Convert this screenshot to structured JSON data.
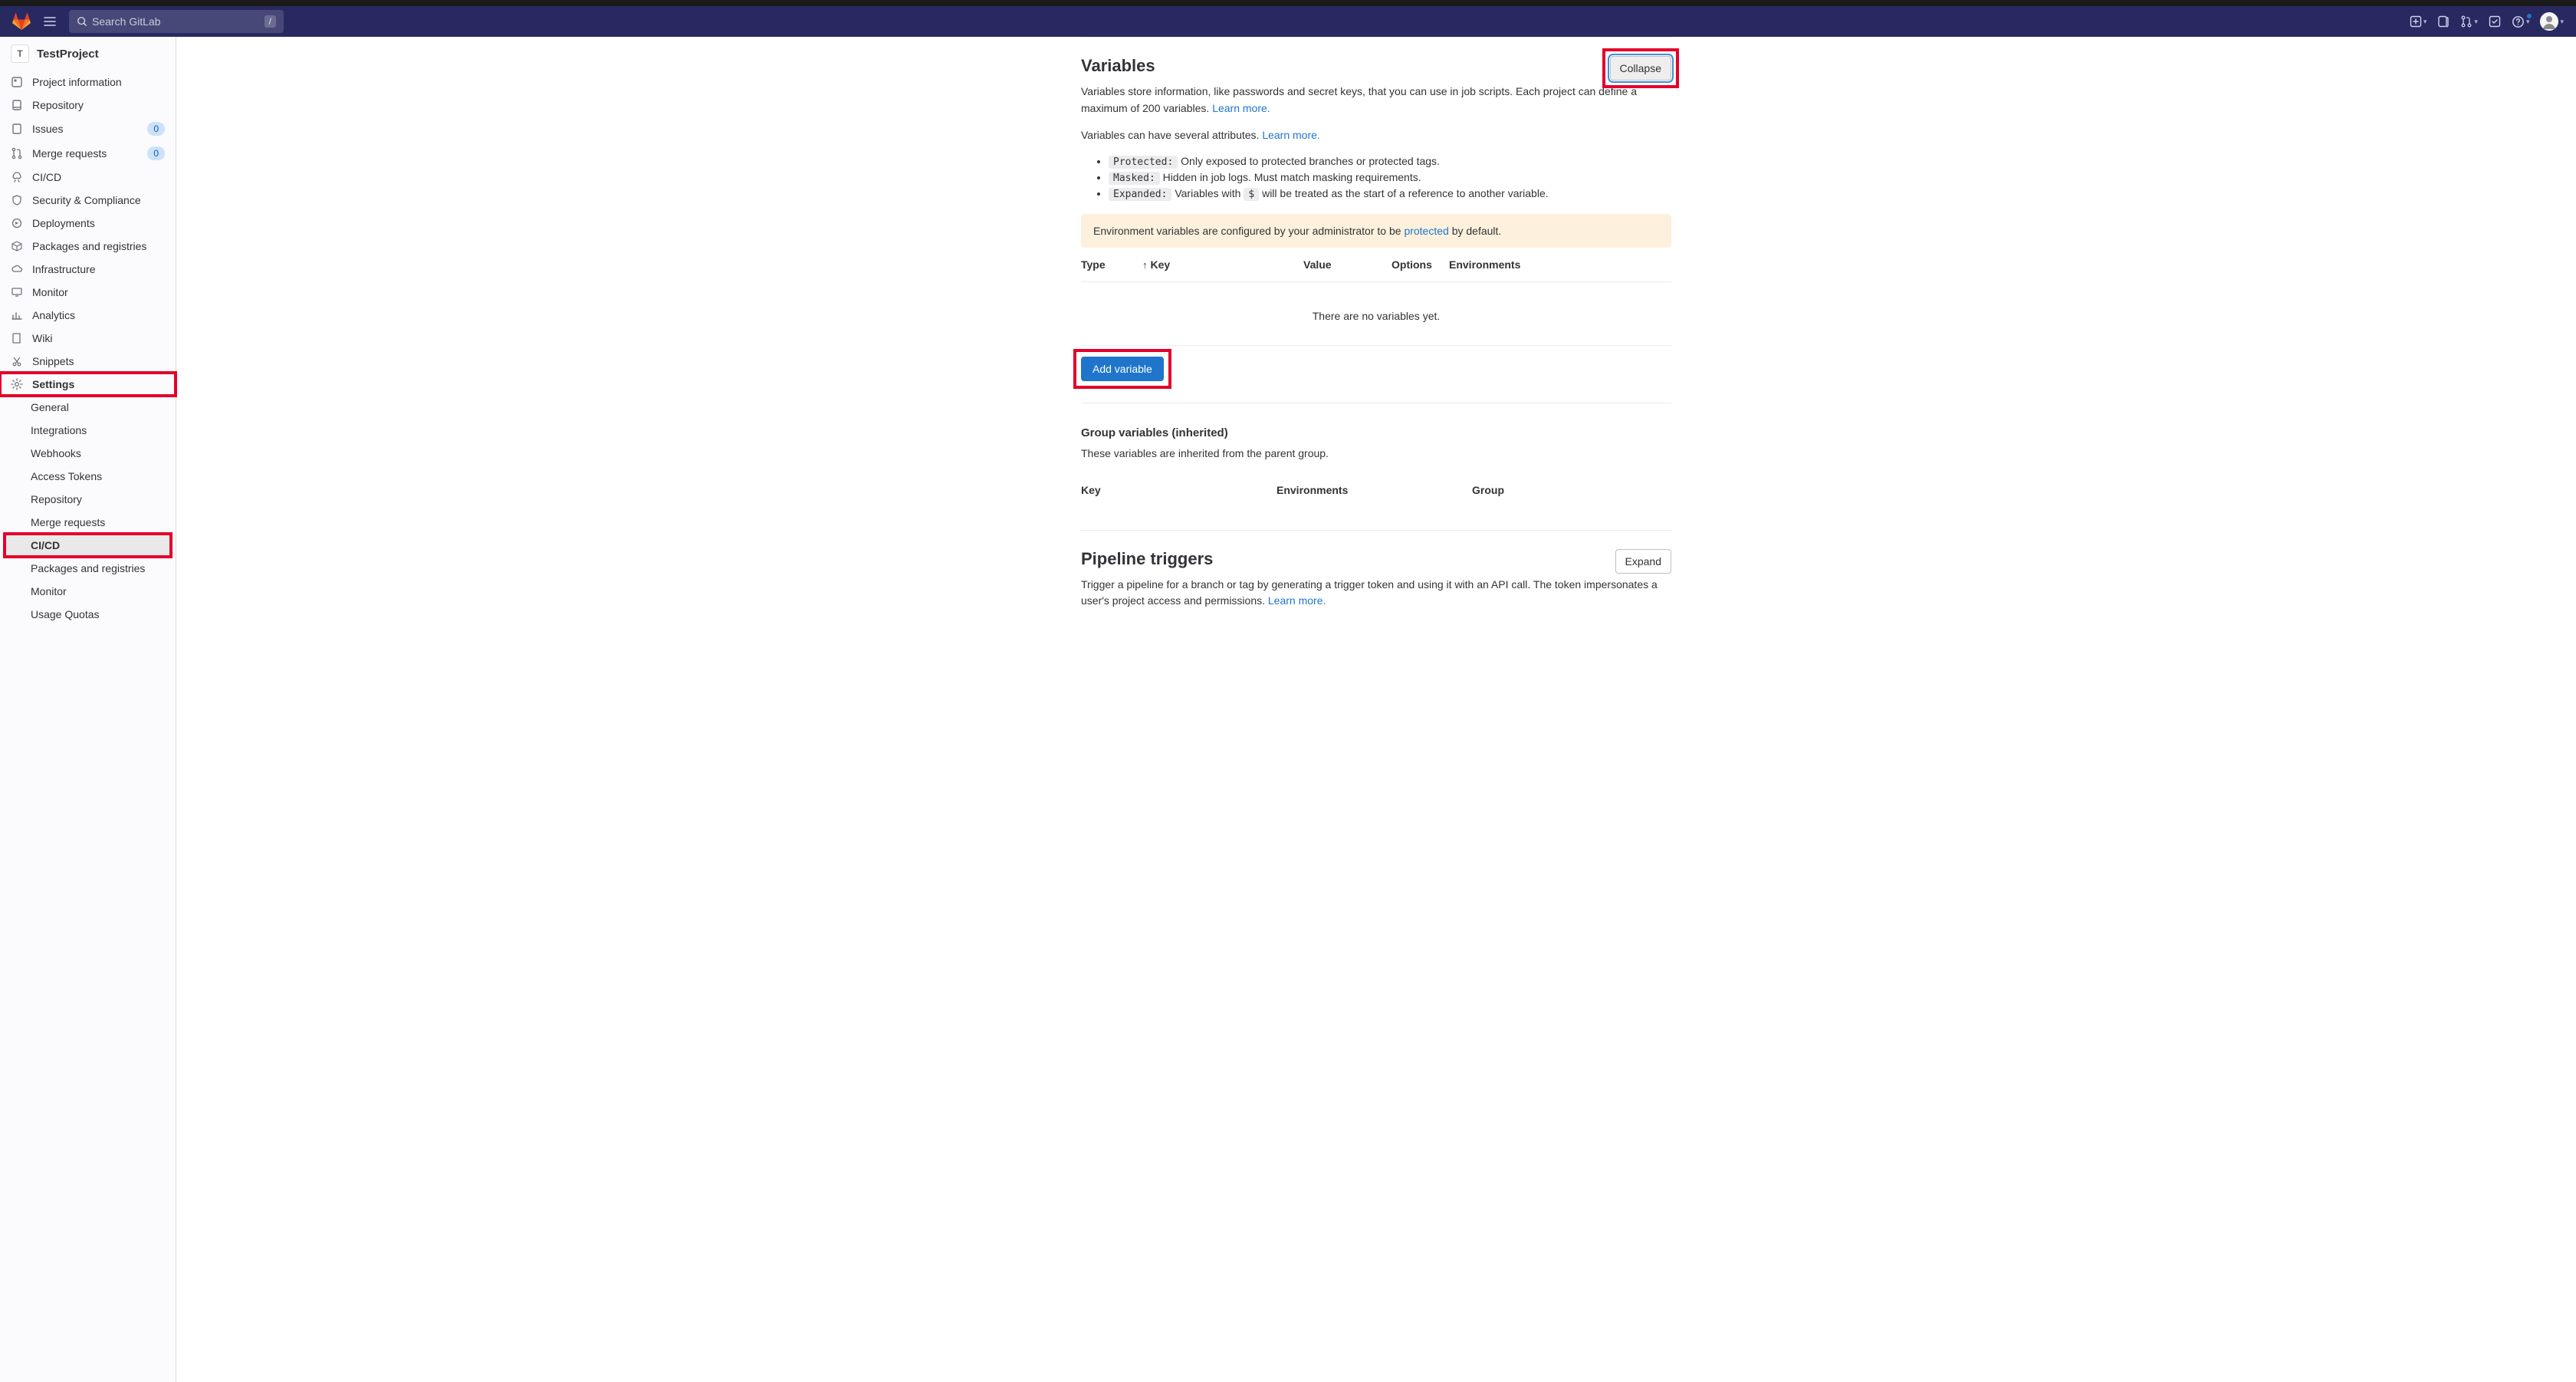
{
  "topbar": {
    "search_placeholder": "Search GitLab",
    "search_kbd": "/"
  },
  "project": {
    "avatar_letter": "T",
    "name": "TestProject"
  },
  "sidebar": {
    "items": [
      {
        "label": "Project information"
      },
      {
        "label": "Repository"
      },
      {
        "label": "Issues",
        "badge": "0"
      },
      {
        "label": "Merge requests",
        "badge": "0"
      },
      {
        "label": "CI/CD"
      },
      {
        "label": "Security & Compliance"
      },
      {
        "label": "Deployments"
      },
      {
        "label": "Packages and registries"
      },
      {
        "label": "Infrastructure"
      },
      {
        "label": "Monitor"
      },
      {
        "label": "Analytics"
      },
      {
        "label": "Wiki"
      },
      {
        "label": "Snippets"
      },
      {
        "label": "Settings"
      }
    ],
    "sub": [
      {
        "label": "General"
      },
      {
        "label": "Integrations"
      },
      {
        "label": "Webhooks"
      },
      {
        "label": "Access Tokens"
      },
      {
        "label": "Repository"
      },
      {
        "label": "Merge requests"
      },
      {
        "label": "CI/CD"
      },
      {
        "label": "Packages and registries"
      },
      {
        "label": "Monitor"
      },
      {
        "label": "Usage Quotas"
      }
    ]
  },
  "variables": {
    "title": "Variables",
    "collapse_btn": "Collapse",
    "desc1": "Variables store information, like passwords and secret keys, that you can use in job scripts. Each project can define a maximum of 200 variables. ",
    "learn_more": "Learn more.",
    "desc2": "Variables can have several attributes. ",
    "attrs": {
      "protected_tag": "Protected:",
      "protected_desc": " Only exposed to protected branches or protected tags.",
      "masked_tag": "Masked:",
      "masked_desc": " Hidden in job logs. Must match masking requirements.",
      "expanded_tag": "Expanded:",
      "expanded_desc_pre": " Variables with ",
      "expanded_code": "$",
      "expanded_desc_post": " will be treated as the start of a reference to another variable."
    },
    "alert_pre": "Environment variables are configured by your administrator to be ",
    "alert_link": "protected",
    "alert_post": " by default.",
    "cols": {
      "type": "Type",
      "key": "Key",
      "value": "Value",
      "options": "Options",
      "env": "Environments"
    },
    "empty": "There are no variables yet.",
    "add_btn": "Add variable",
    "group_title": "Group variables (inherited)",
    "group_desc": "These variables are inherited from the parent group.",
    "group_cols": {
      "key": "Key",
      "env": "Environments",
      "group": "Group"
    }
  },
  "triggers": {
    "title": "Pipeline triggers",
    "expand_btn": "Expand",
    "desc": "Trigger a pipeline for a branch or tag by generating a trigger token and using it with an API call. The token impersonates a user's project access and permissions. ",
    "learn_more": "Learn more."
  }
}
